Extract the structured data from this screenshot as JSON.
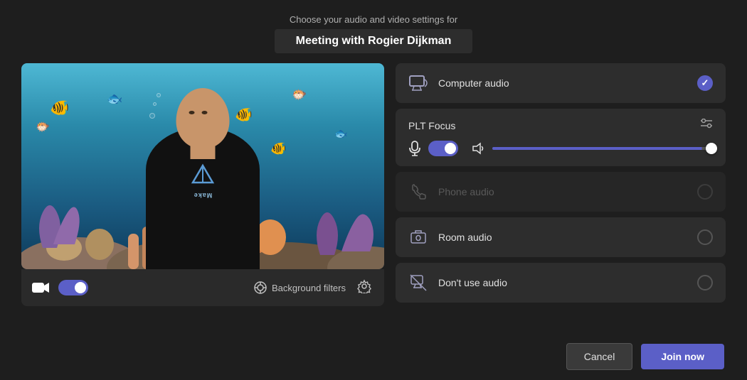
{
  "header": {
    "subtitle": "Choose your audio and video settings for",
    "title": "Meeting with Rogier Dijkman"
  },
  "video_controls": {
    "bg_filters_label": "Background filters"
  },
  "audio_panel": {
    "computer_audio": {
      "label": "Computer audio",
      "checked": true
    },
    "plt_section": {
      "title": "PLT Focus",
      "settings_icon": "sliders-icon"
    },
    "phone_audio": {
      "label": "Phone audio",
      "checked": false,
      "dimmed": true
    },
    "room_audio": {
      "label": "Room audio",
      "checked": false
    },
    "dont_use_audio": {
      "label": "Don't use audio",
      "checked": false
    }
  },
  "buttons": {
    "cancel": "Cancel",
    "join_now": "Join now"
  }
}
